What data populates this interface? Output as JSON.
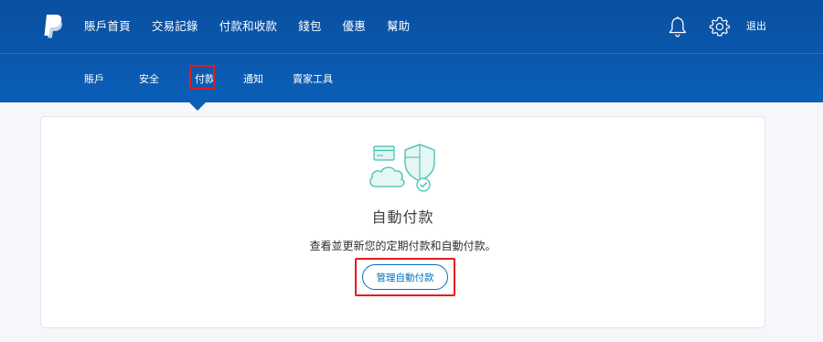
{
  "header": {
    "nav": [
      {
        "label": "賬戶首頁"
      },
      {
        "label": "交易記錄"
      },
      {
        "label": "付款和收款"
      },
      {
        "label": "錢包"
      },
      {
        "label": "優惠"
      },
      {
        "label": "幫助"
      }
    ],
    "logout_label": "退出",
    "icons": {
      "logo": "paypal-logo-icon",
      "notifications": "bell-icon",
      "settings": "gear-icon"
    }
  },
  "subnav": {
    "items": [
      {
        "label": "賬戶"
      },
      {
        "label": "安全"
      },
      {
        "label": "付款"
      },
      {
        "label": "通知"
      },
      {
        "label": "賣家工具"
      }
    ],
    "active_index": 2
  },
  "card": {
    "title": "自動付款",
    "description": "查看並更新您的定期付款和自動付款。",
    "button_label": "管理自動付款",
    "illustration_icon": "payment-shield-cloud-icon"
  },
  "colors": {
    "header_bg": "#0b5fb8",
    "accent": "#0070ba",
    "highlight": "#e31b1b",
    "illustration": "#3fbfb0"
  }
}
